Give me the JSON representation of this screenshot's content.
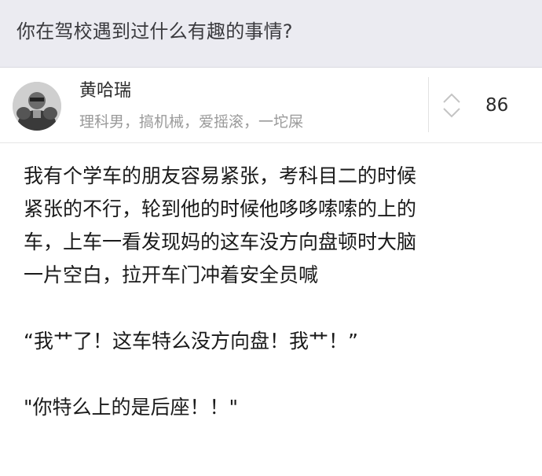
{
  "question": {
    "title": "你在驾校遇到过什么有趣的事情?"
  },
  "author": {
    "name": "黄哈瑞",
    "bio": "理科男，搞机械，爱摇滚，一坨屎",
    "avatar_icon": "user-avatar-icon"
  },
  "vote": {
    "count": "86",
    "icon": "up-down-vote-icon"
  },
  "answer": {
    "lines": [
      "我有个学车的朋友容易紧张，考科目二的时候",
      "紧张的不行，轮到他的时候他哆哆嗦嗦的上的",
      "车，上车一看发现妈的这车没方向盘顿时大脑",
      "一片空白，拉开车门冲着安全员喊",
      "",
      "“我艹了！这车特么没方向盘！我艹！”",
      "",
      "\"你特么上的是后座！！\""
    ]
  },
  "colors": {
    "header_bg": "#ebebf1",
    "bio_text": "#9a9a9a"
  }
}
